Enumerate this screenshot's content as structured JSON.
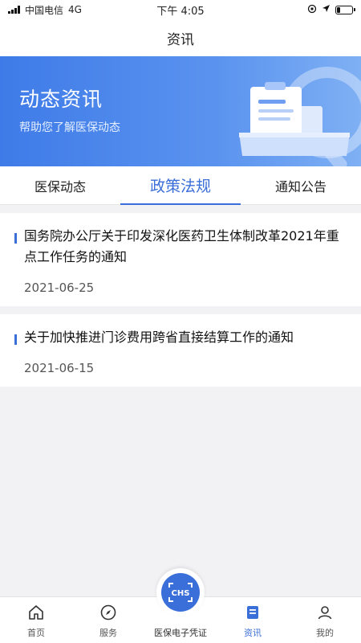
{
  "status_bar": {
    "carrier": "中国电信",
    "network": "4G",
    "time": "下午 4:05",
    "battery_level": 0.25
  },
  "nav": {
    "title": "资讯"
  },
  "banner": {
    "title": "动态资讯",
    "subtitle": "帮助您了解医保动态"
  },
  "tabs": [
    {
      "label": "医保动态",
      "active": false
    },
    {
      "label": "政策法规",
      "active": true
    },
    {
      "label": "通知公告",
      "active": false
    }
  ],
  "news": [
    {
      "title": "国务院办公厅关于印发深化医药卫生体制改革2021年重点工作任务的通知",
      "date": "2021-06-25"
    },
    {
      "title": "关于加快推进门诊费用跨省直接结算工作的通知",
      "date": "2021-06-15"
    }
  ],
  "tabbar": {
    "items": [
      {
        "label": "首页",
        "icon": "home-icon"
      },
      {
        "label": "服务",
        "icon": "compass-icon"
      },
      {
        "label": "医保电子凭证",
        "icon": "chs-scan-icon"
      },
      {
        "label": "资讯",
        "icon": "news-icon",
        "active": true
      },
      {
        "label": "我的",
        "icon": "user-icon"
      }
    ],
    "center_logo_text": "CHS"
  },
  "colors": {
    "accent": "#3a6ed8",
    "banner_start": "#3f7be8",
    "banner_end": "#7fb0f4"
  }
}
